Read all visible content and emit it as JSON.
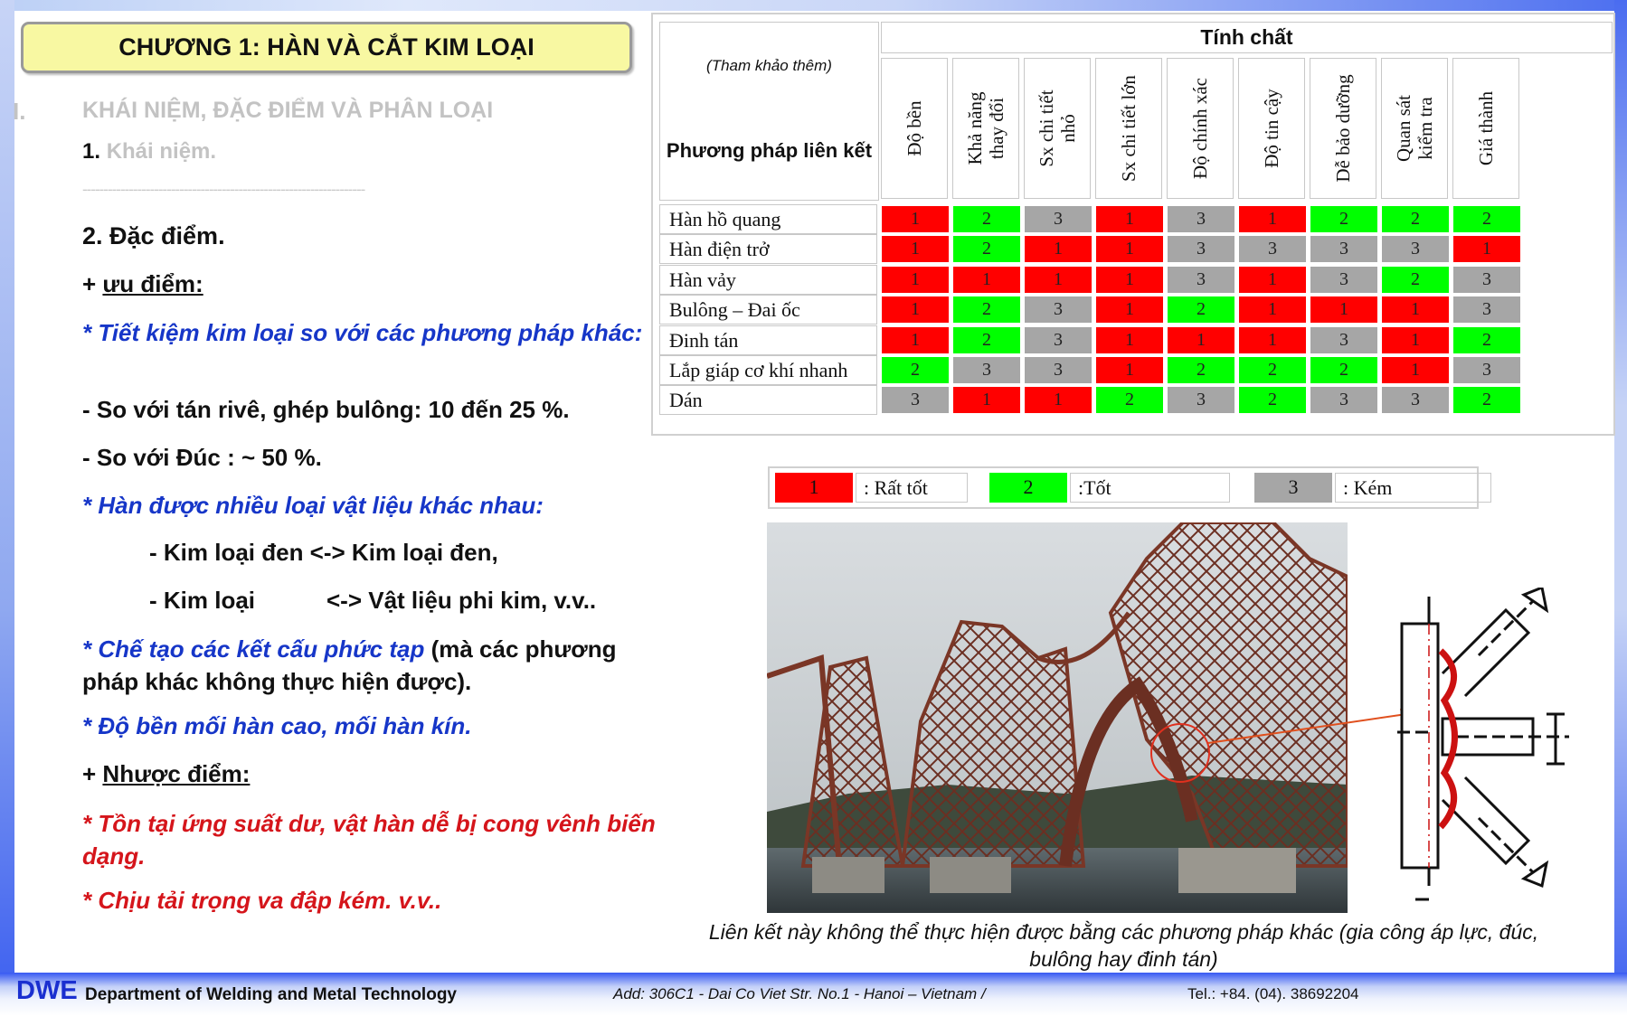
{
  "chapter_title": "CHƯƠNG 1: HÀN VÀ CẮT KIM LOẠI",
  "section": {
    "roman": "I.",
    "title": "KHÁI NIỆM, ĐẶC ĐIỂM VÀ PHÂN LOẠI"
  },
  "subsection1": {
    "num": "1.",
    "title": "Khái niệm."
  },
  "divider": "-------------------------------------------------------------------",
  "subsection2": "2. Đặc điểm.",
  "advantages_label": {
    "prefix": "+ ",
    "text": "ưu điểm:"
  },
  "points": {
    "p1": "* Tiết kiệm kim loại so với các phương pháp khác:",
    "p1a": "- So với tán rivê, ghép bulông: 10 đến 25 %.",
    "p1b": "- So với Đúc  : ~ 50 %.",
    "p2": "* Hàn được nhiều loại vật liệu khác nhau:",
    "p2a": "- Kim loại đen <-> Kim loại đen,",
    "p2b_left": "- Kim loại",
    "p2b_right": "<-> Vật liệu phi kim, v.v..",
    "p3_blue": "* Chế tạo các kết cấu phức tạp",
    "p3_black": " (mà các phương pháp khác không thực hiện được).",
    "p4": "* Độ bền mối hàn cao, mối hàn kín."
  },
  "disadvantages_label": {
    "prefix": "+ ",
    "text": "Nhược điểm:"
  },
  "disadvantages": {
    "d1": "* Tồn tại ứng suất dư, vật hàn dễ bị cong vênh biến dạng.",
    "d2": "* Chịu tải trọng va đập kém. v.v.."
  },
  "table": {
    "reference_note": "(Tham khảo thêm)",
    "method_header": "Phương pháp liên kết",
    "property_header": "Tính chất",
    "columns": [
      "Độ bền",
      "Khả năng thay đổi",
      "Sx chi tiết nhỏ",
      "Sx chi tiết lớn",
      "Độ chính xác",
      "Độ tin cậy",
      "Dễ bảo dưỡng",
      "Quan sát kiểm tra",
      "Giá thành"
    ],
    "rows": [
      {
        "method": "Hàn hồ quang",
        "values": [
          1,
          2,
          3,
          1,
          3,
          1,
          2,
          2,
          2
        ]
      },
      {
        "method": "Hàn điện trở",
        "values": [
          1,
          2,
          1,
          1,
          3,
          3,
          3,
          3,
          1
        ]
      },
      {
        "method": "Hàn vảy",
        "values": [
          1,
          1,
          1,
          1,
          3,
          1,
          3,
          2,
          3
        ]
      },
      {
        "method": "Bulông – Đai ốc",
        "values": [
          1,
          2,
          3,
          1,
          2,
          1,
          1,
          1,
          3
        ]
      },
      {
        "method": "Đinh tán",
        "values": [
          1,
          2,
          3,
          1,
          1,
          1,
          3,
          1,
          2
        ]
      },
      {
        "method": "Lắp giáp cơ khí nhanh",
        "values": [
          2,
          3,
          3,
          1,
          2,
          2,
          2,
          1,
          3
        ]
      },
      {
        "method": "Dán",
        "values": [
          3,
          1,
          1,
          2,
          3,
          2,
          3,
          3,
          2
        ]
      }
    ],
    "colors": {
      "1": "#ff0000",
      "2": "#00ff00",
      "3": "#a6a6a6"
    }
  },
  "legend": [
    {
      "value": "1",
      "label": ": Rất tốt"
    },
    {
      "value": "2",
      "label": ":Tốt"
    },
    {
      "value": "3",
      "label": ": Kém"
    }
  ],
  "caption": "Liên kết này không thể thực hiện được bằng các phương pháp khác (gia công áp lực, đúc, bulông hay đinh tán)",
  "footer": {
    "logo": "DWE",
    "department": "Department of Welding and Metal Technology",
    "address": "Add: 306C1 - Dai Co Viet Str. No.1 - Hanoi – Vietnam /",
    "tel": "Tel.: +84. (04). 38692204"
  }
}
